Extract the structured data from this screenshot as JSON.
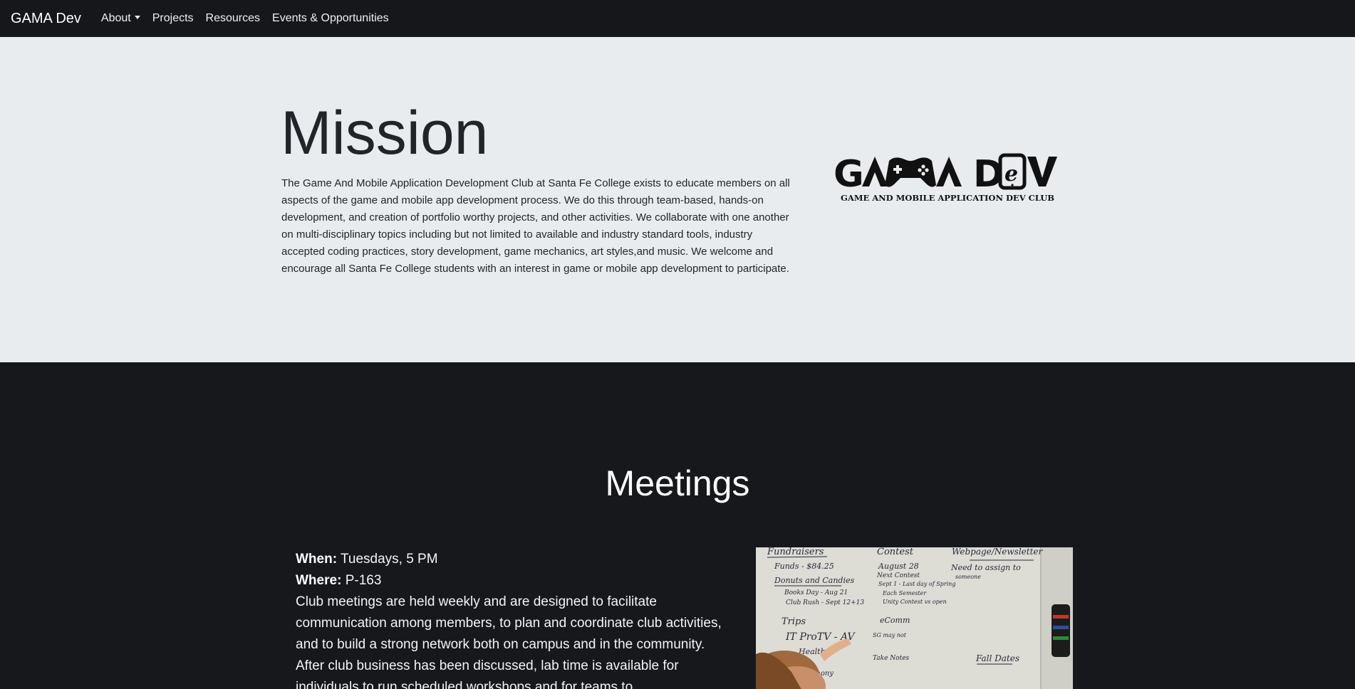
{
  "nav": {
    "brand": "GAMA Dev",
    "items": [
      {
        "label": "About",
        "dropdown": true
      },
      {
        "label": "Projects"
      },
      {
        "label": "Resources"
      },
      {
        "label": "Events & Opportunities"
      }
    ]
  },
  "mission": {
    "title": "Mission",
    "text": "The Game And Mobile Application Development Club at Santa Fe College exists to educate members on all aspects of the game and mobile app development process. We do this through team-based, hands-on development, and creation of portfolio worthy projects, and other activities. We collaborate with one another on multi-disciplinary topics including but not limited to available and industry standard tools, industry accepted coding practices, story development, game mechanics, art styles,and music. We welcome and encourage all Santa Fe College students with an interest in game or mobile app development to participate.",
    "logo": {
      "wordmark": "GAMA DeV",
      "tagline": "GAME AND MOBILE APPLICATION DEV CLUB"
    }
  },
  "meetings": {
    "title": "Meetings",
    "when_label": "When:",
    "when_value": "Tuesdays, 5 PM",
    "where_label": "Where:",
    "where_value": "P-163",
    "description": "Club meetings are held weekly and are designed to facilitate communication among members, to plan and coordinate club activities, and to build a strong network both on campus and in the community. After club business has been discussed, lab time is available for individuals to run scheduled workshops and for teams to",
    "photo": {
      "notes": [
        "Fundraisers",
        "Contest",
        "Webpage/Newsletter",
        "Funds - $84.25",
        "August 28",
        "Need to assign to",
        "Donuts and Candies",
        "Next Contest",
        "someone",
        "Books Day - Aug 21",
        "Sept 1 - Last day of Spring",
        "Club Rush - Sept 12+13",
        "Each Semester",
        "Unity Contest vs open",
        "Trips",
        "eComm",
        "IT ProTV - AV",
        "Health",
        "SG may not",
        "Fall Dates",
        "Take Notes",
        "Symphony"
      ]
    }
  },
  "colors": {
    "navbar_bg": "#15171b",
    "mission_bg": "#e9ecef",
    "meetings_bg": "#17181c"
  }
}
